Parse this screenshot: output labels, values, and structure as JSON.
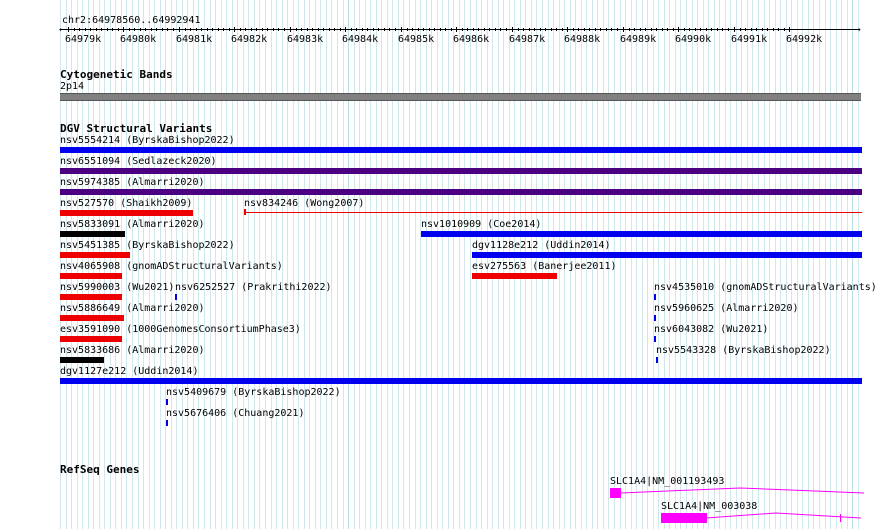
{
  "ruler": {
    "coords_label": "chr2:64978560..64992941",
    "ticks": [
      "64979k",
      "64980k",
      "64981k",
      "64982k",
      "64983k",
      "64984k",
      "64985k",
      "64986k",
      "64987k",
      "64988k",
      "64989k",
      "64990k",
      "64991k",
      "64992k"
    ]
  },
  "tracks": {
    "cytoband": {
      "title": "Cytogenetic Bands",
      "band_label": "2p14"
    },
    "dgv": {
      "title": "DGV Structural Variants",
      "colors": {
        "gain": "#0000ee",
        "loss": "#ee0000",
        "gain_loss": "#4b0082",
        "other": "#000000"
      },
      "features": [
        {
          "label": "nsv5554214 (ByrskaBishop2022)"
        },
        {
          "label": "nsv6551094 (Sedlazeck2020)"
        },
        {
          "label": "nsv5974385 (Almarri2020)"
        },
        {
          "label": "nsv527570 (Shaikh2009)"
        },
        {
          "label": "nsv834246 (Wong2007)"
        },
        {
          "label": "nsv5833091 (Almarri2020)"
        },
        {
          "label": "nsv1010909 (Coe2014)"
        },
        {
          "label": "nsv5451385 (ByrskaBishop2022)"
        },
        {
          "label": "dgv1128e212 (Uddin2014)"
        },
        {
          "label": "nsv4065908 (gnomADStructuralVariants)"
        },
        {
          "label": "esv275563 (Banerjee2011)"
        },
        {
          "label": "nsv5990003 (Wu2021)"
        },
        {
          "label": "nsv6252527 (Prakrithi2022)"
        },
        {
          "label": "nsv4535010 (gnomADStructuralVariants)"
        },
        {
          "label": "nsv5886649 (Almarri2020)"
        },
        {
          "label": "nsv5960625 (Almarri2020)"
        },
        {
          "label": "esv3591090 (1000GenomesConsortiumPhase3)"
        },
        {
          "label": "nsv6043082 (Wu2021)"
        },
        {
          "label": "nsv5833686 (Almarri2020)"
        },
        {
          "label": "nsv5543328 (ByrskaBishop2022)"
        },
        {
          "label": "dgv1127e212 (Uddin2014)"
        },
        {
          "label": "nsv5409679 (ByrskaBishop2022)"
        },
        {
          "label": "nsv5676406 (Chuang2021)"
        }
      ]
    },
    "refseq": {
      "title": "RefSeq Genes",
      "color": "#ff00ff",
      "genes": [
        {
          "label": "SLC1A4|NM_001193493"
        },
        {
          "label": "SLC1A4|NM_003038"
        }
      ]
    }
  }
}
